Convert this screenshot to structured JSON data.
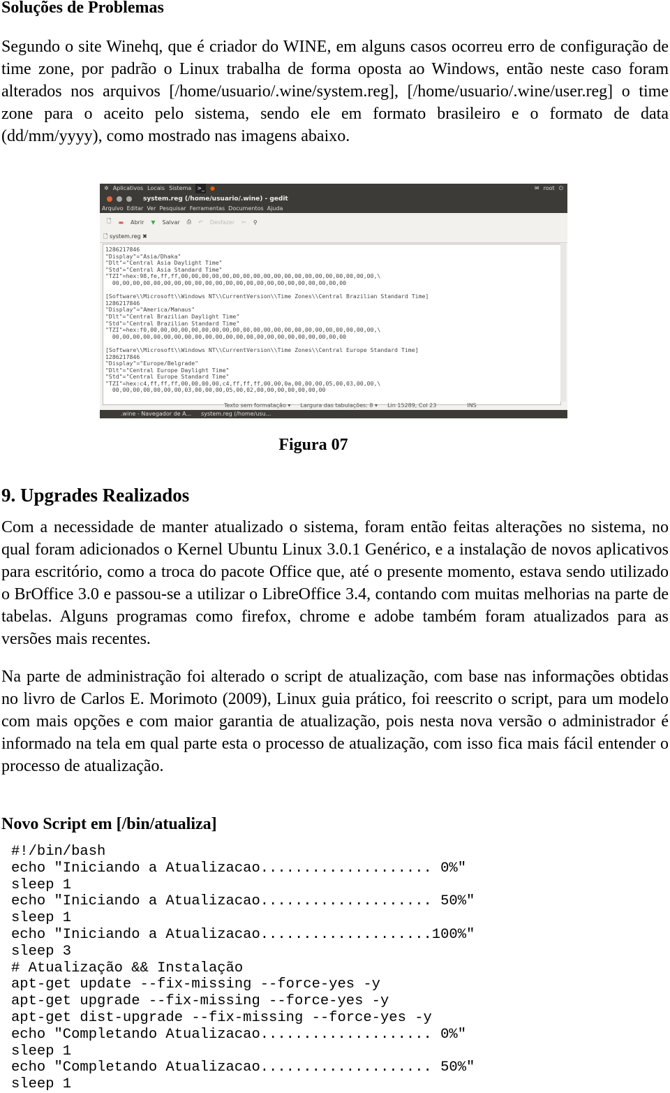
{
  "section_title": "Soluções de Problemas",
  "paragraph1": "Segundo o site Winehq, que é criador do WINE, em alguns casos ocorreu erro de configuração de time zone, por padrão o Linux trabalha de forma oposta ao Windows, então neste caso foram alterados nos arquivos [/home/usuario/.wine/system.reg], [/home/usuario/.wine/user.reg] o time zone para o aceito pelo sistema, sendo ele em formato brasileiro e o formato de data (dd/mm/yyyy), como mostrado nas imagens abaixo.",
  "screenshot": {
    "topbar": [
      "Aplicativos",
      "Locais",
      "Sistema"
    ],
    "topbar_user": "root",
    "window_title": "system.reg (/home/usuario/.wine) - gedit",
    "menu": [
      "Arquivo",
      "Editar",
      "Ver",
      "Pesquisar",
      "Ferramentas",
      "Documentos",
      "Ajuda"
    ],
    "toolbar": {
      "open": "Abrir",
      "save": "Salvar",
      "undo": "Desfazer"
    },
    "tab": "system.reg",
    "editor_lines": [
      "1286217846",
      "\"Display\"=\"Asia/Dhaka\"",
      "\"Dlt\"=\"Central Asia Daylight Time\"",
      "\"Std\"=\"Central Asia Standard Time\"",
      "\"TZI\"=hex:98,fe,ff,ff,00,00,00,00,00,00,00,00,00,00,00,00,00,00,00,00,00,00,00,\\",
      "  00,00,00,00,00,00,00,00,00,00,00,00,00,00,00,00,00,00,00,00,00,00,00",
      "",
      "[Software\\\\Microsoft\\\\Windows NT\\\\CurrentVersion\\\\Time Zones\\\\Central Brazilian Standard Time]",
      "1286217846",
      "\"Display\"=\"America/Manaus\"",
      "\"Dlt\"=\"Central Brazilian Daylight Time\"",
      "\"Std\"=\"Central Brazilian Standard Time\"",
      "\"TZI\"=hex:f0,00,00,00,00,00,00,00,00,00,00,00,00,00,00,00,00,00,00,00,00,00,00,\\",
      "  00,00,00,00,00,00,00,00,00,00,00,00,00,00,00,00,00,00,00,00,00,00,00",
      "",
      "[Software\\\\Microsoft\\\\Windows NT\\\\CurrentVersion\\\\Time Zones\\\\Central Europe Standard Time]",
      "1286217846",
      "\"Display\"=\"Europe/Belgrade\"",
      "\"Dlt\"=\"Central Europe Daylight Time\"",
      "\"Std\"=\"Central Europe Standard Time\"",
      "\"TZI\"=hex:c4,ff,ff,ff,00,00,00,00,c4,ff,ff,ff,00,00,0a,00,00,00,05,00,03,00,00,\\",
      "  00,00,00,00,00,00,00,03,00,00,00,05,00,02,00,00,00,00,00,00,00"
    ],
    "status": [
      "Texto sem formatação ▾",
      "Largura das tabulações: 8 ▾",
      "Lin 15289, Col 23",
      "INS"
    ],
    "taskbar": [
      ".wine - Navegador de A...",
      "system.reg (/home/usu..."
    ]
  },
  "figure_caption": "Figura 07",
  "section2_title": "9. Upgrades Realizados",
  "paragraph2": "Com a necessidade de manter atualizado o sistema, foram então feitas alterações no sistema, no qual foram adicionados o Kernel Ubuntu Linux 3.0.1 Genérico, e a instalação de novos aplicativos para escritório, como a troca do pacote Office que, até o presente momento, estava sendo utilizado o BrOffice 3.0 e passou-se a utilizar o LibreOffice 3.4, contando com muitas melhorias na parte de tabelas. Alguns programas como firefox, chrome e adobe também foram atualizados para as versões mais recentes.",
  "paragraph3": "Na parte de administração foi alterado o script de atualização, com base nas informações obtidas no livro de Carlos E. Morimoto (2009), Linux guia prático, foi reescrito o script, para um modelo com mais opções e com maior garantia de atualização, pois nesta nova versão o administrador é informado na tela em qual parte esta o processo de atualização, com isso fica mais fácil entender o processo de atualização.",
  "script_title": "Novo Script em [/bin/atualiza]",
  "script_lines": [
    "#!/bin/bash",
    "echo \"Iniciando a Atualizacao.................... 0%\"",
    "sleep 1",
    "echo \"Iniciando a Atualizacao.................... 50%\"",
    "sleep 1",
    "echo \"Iniciando a Atualizacao....................100%\"",
    "sleep 3",
    "# Atualização && Instalação",
    "apt-get update --fix-missing --force-yes -y",
    "apt-get upgrade --fix-missing --force-yes -y",
    "apt-get dist-upgrade --fix-missing --force-yes -y",
    "echo \"Completando Atualizacao.................... 0%\"",
    "sleep 1",
    "echo \"Completando Atualizacao.................... 50%\"",
    "sleep 1"
  ]
}
